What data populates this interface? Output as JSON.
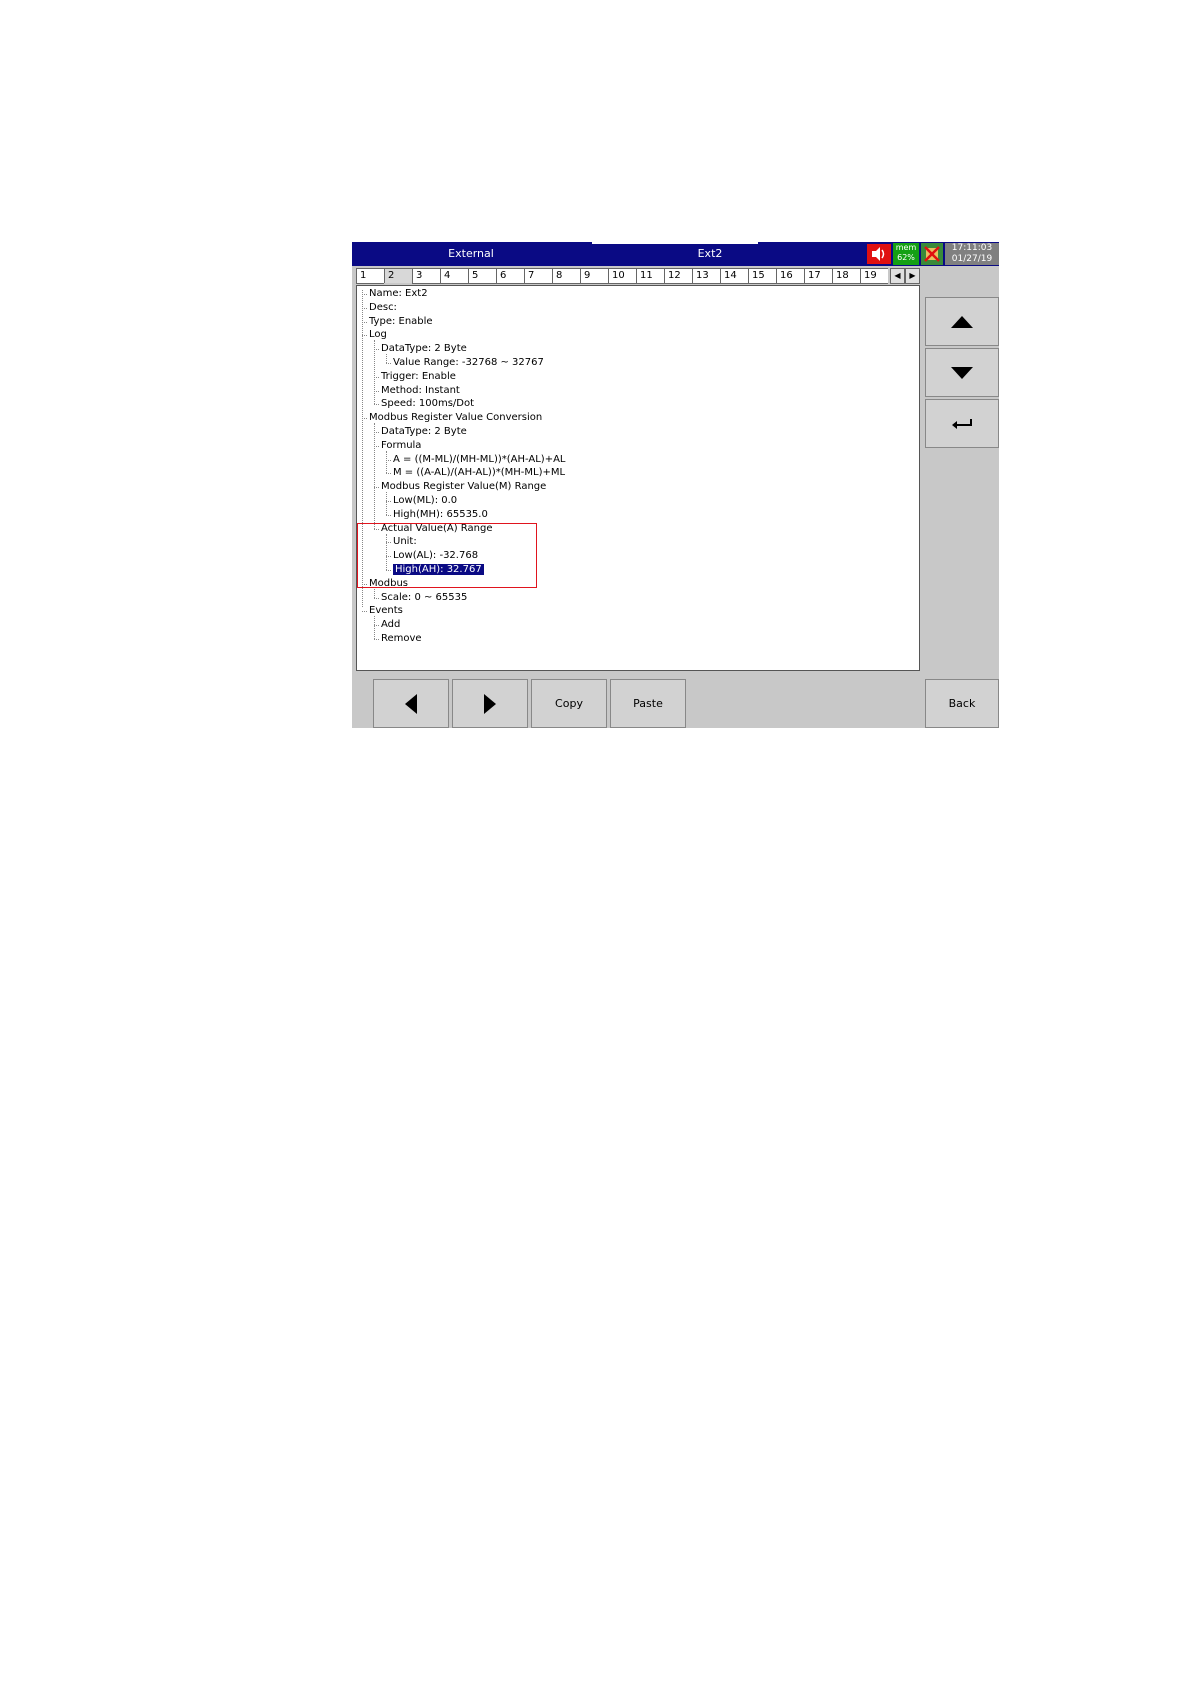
{
  "titlebar": {
    "left_title": "External",
    "right_title": "Ext2",
    "mem_label": "mem",
    "mem_value": "62%",
    "time": "17:11:03",
    "date": "01/27/19",
    "icons": [
      "speaker-icon",
      "alarm-icon"
    ]
  },
  "tabs": {
    "items": [
      "1",
      "2",
      "3",
      "4",
      "5",
      "6",
      "7",
      "8",
      "9",
      "10",
      "11",
      "12",
      "13",
      "14",
      "15",
      "16",
      "17",
      "18",
      "19"
    ],
    "active": "2"
  },
  "tree": {
    "nodes": [
      {
        "label": "Name: Ext2",
        "level": 0
      },
      {
        "label": "Desc:",
        "level": 0
      },
      {
        "label": "Type: Enable",
        "level": 0
      },
      {
        "label": "Log",
        "level": 0
      },
      {
        "label": "DataType: 2 Byte",
        "level": 1
      },
      {
        "label": "Value Range: -32768 ~ 32767",
        "level": 2
      },
      {
        "label": "Trigger: Enable",
        "level": 1
      },
      {
        "label": "Method: Instant",
        "level": 1
      },
      {
        "label": "Speed: 100ms/Dot",
        "level": 1
      },
      {
        "label": "Modbus Register Value Conversion",
        "level": 0
      },
      {
        "label": "DataType: 2 Byte",
        "level": 1
      },
      {
        "label": "Formula",
        "level": 1
      },
      {
        "label": "A = ((M-ML)/(MH-ML))*(AH-AL)+AL",
        "level": 2
      },
      {
        "label": "M = ((A-AL)/(AH-AL))*(MH-ML)+ML",
        "level": 2
      },
      {
        "label": "Modbus Register Value(M) Range",
        "level": 1
      },
      {
        "label": "Low(ML): 0.0",
        "level": 2
      },
      {
        "label": "High(MH): 65535.0",
        "level": 2
      },
      {
        "label": "Actual Value(A) Range",
        "level": 1
      },
      {
        "label": "Unit:",
        "level": 2
      },
      {
        "label": "Low(AL): -32.768",
        "level": 2
      },
      {
        "label": "High(AH): 32.767",
        "level": 2,
        "selected": true
      },
      {
        "label": "Modbus",
        "level": 0
      },
      {
        "label": "Scale: 0 ~ 65535",
        "level": 1
      },
      {
        "label": "Events",
        "level": 0
      },
      {
        "label": "Add",
        "level": 1
      },
      {
        "label": "Remove",
        "level": 1
      }
    ]
  },
  "side_buttons": {
    "up_icon": "triangle-up-icon",
    "down_icon": "triangle-down-icon",
    "enter_icon": "enter-arrow-icon"
  },
  "bottom_buttons": {
    "prev_icon": "triangle-left-icon",
    "next_icon": "triangle-right-icon",
    "copy_label": "Copy",
    "paste_label": "Paste",
    "back_label": "Back"
  },
  "colors": {
    "titlebar": "#0a0a84",
    "highlight_box": "#e0141e",
    "selection": "#0a0a84",
    "panel_gray": "#c8c8c8"
  }
}
